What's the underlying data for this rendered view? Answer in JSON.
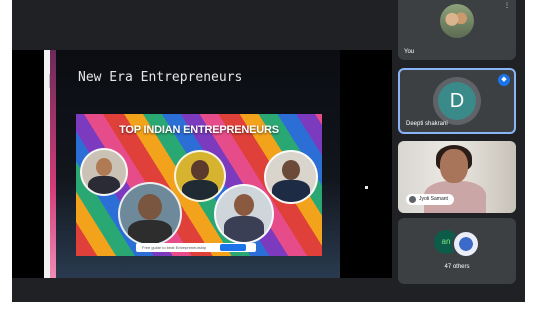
{
  "slide": {
    "title": "New Era Entrepreneurs",
    "poster_title": "TOP INDIAN ENTREPRENEURS",
    "poster_bar_text": "Free guide to beat Entrepreneurship",
    "poster_bar_button": "Start Reading"
  },
  "participants": {
    "you": {
      "label": "You"
    },
    "deepti": {
      "label": "Deepti shakrani",
      "initial": "D"
    },
    "jyoti": {
      "label": "Jyoti Samant"
    },
    "others": {
      "label": "47 others",
      "initial": "an"
    }
  },
  "colors": {
    "background": "#202124",
    "tile": "#3c4043",
    "accent": "#1a73e8",
    "active_border": "#8ab4f8"
  }
}
